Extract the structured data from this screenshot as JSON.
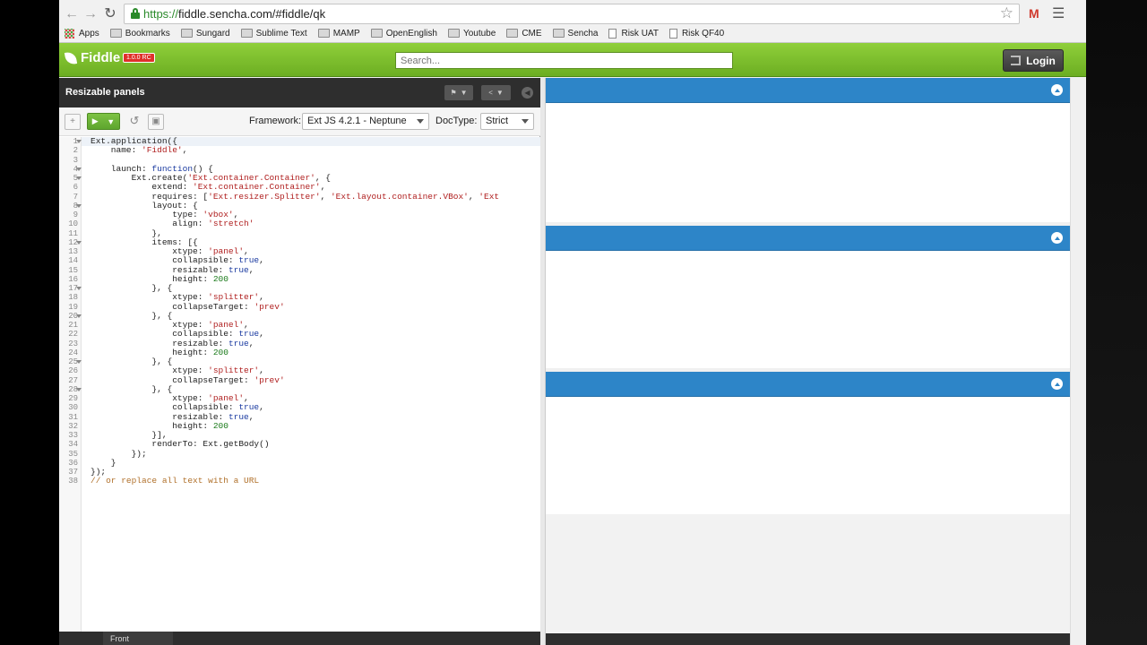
{
  "browser": {
    "url_scheme": "https://",
    "url_rest": "fiddle.sencha.com/#fiddle/qk",
    "bookmarks": [
      {
        "label": "Apps",
        "icon": "apps-grid-icon"
      },
      {
        "label": "Bookmarks",
        "icon": "folder-icon"
      },
      {
        "label": "Sungard",
        "icon": "folder-icon"
      },
      {
        "label": "Sublime Text",
        "icon": "folder-icon"
      },
      {
        "label": "MAMP",
        "icon": "folder-icon"
      },
      {
        "label": "OpenEnglish",
        "icon": "folder-icon"
      },
      {
        "label": "Youtube",
        "icon": "folder-icon"
      },
      {
        "label": "CME",
        "icon": "folder-icon"
      },
      {
        "label": "Sencha",
        "icon": "folder-icon"
      },
      {
        "label": "Risk UAT",
        "icon": "page-icon"
      },
      {
        "label": "Risk QF40",
        "icon": "page-icon"
      }
    ]
  },
  "header": {
    "app_name": "Fiddle",
    "version_badge": "1.0.0 RC",
    "search_placeholder": "Search...",
    "login_label": "Login",
    "accent_color": "#7bbd2e"
  },
  "editor_panel": {
    "title": "Resizable panels",
    "framework_label": "Framework:",
    "framework_value": "Ext JS 4.2.1 - Neptune",
    "doctype_label": "DocType:",
    "doctype_value": "Strict",
    "bottom_tab": "Front"
  },
  "code_lines": [
    "Ext.application({",
    "    name: 'Fiddle',",
    "",
    "    launch: function() {",
    "        Ext.create('Ext.container.Container', {",
    "            extend: 'Ext.container.Container',",
    "            requires: ['Ext.resizer.Splitter', 'Ext.layout.container.VBox', 'Ext",
    "            layout: {",
    "                type: 'vbox',",
    "                align: 'stretch'",
    "            },",
    "            items: [{",
    "                xtype: 'panel',",
    "                collapsible: true,",
    "                resizable: true,",
    "                height: 200",
    "            }, {",
    "                xtype: 'splitter',",
    "                collapseTarget: 'prev'",
    "            }, {",
    "                xtype: 'panel',",
    "                collapsible: true,",
    "                resizable: true,",
    "                height: 200",
    "            }, {",
    "                xtype: 'splitter',",
    "                collapseTarget: 'prev'",
    "            }, {",
    "                xtype: 'panel',",
    "                collapsible: true,",
    "                resizable: true,",
    "                height: 200",
    "            }],",
    "            renderTo: Ext.getBody()",
    "        });",
    "    }",
    "});",
    "// or replace all text with a URL"
  ],
  "fold_lines": [
    1,
    4,
    5,
    8,
    12,
    17,
    20,
    25,
    28
  ],
  "preview": {
    "header_color": "#2d85c8",
    "panel_count": 3
  }
}
